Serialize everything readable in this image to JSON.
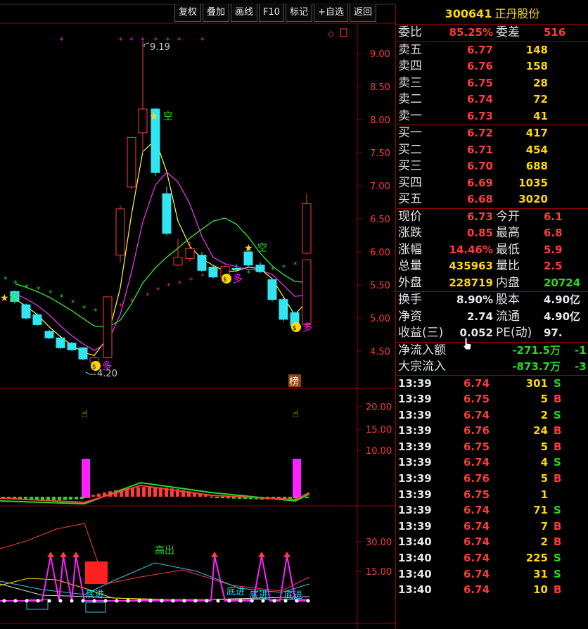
{
  "toolbar": {
    "buttons": [
      "复权",
      "叠加",
      "画线",
      "F10",
      "标记",
      "+自选",
      "返回"
    ]
  },
  "stock": {
    "code": "300641",
    "name": "正丹股份"
  },
  "chart": {
    "main_price_ticks": [
      "9.00",
      "8.50",
      "8.00",
      "7.50",
      "7.00",
      "6.50",
      "6.00",
      "5.50",
      "5.00",
      "4.50"
    ],
    "high_label": "9.19",
    "low_label": "4.20",
    "annotations": {
      "kong1": "空",
      "kong2": "空",
      "kong3": "空",
      "duo1": "多",
      "duo2": "多",
      "duo3": "多",
      "bang": "榜"
    },
    "macd_ticks": [
      "20.00",
      "15.00",
      "10.00"
    ],
    "kdj_ticks": [
      "30.00",
      "15.00"
    ],
    "sub_annotations": {
      "gaochu": "高出",
      "dijin1": "底进",
      "dijin2": "底进",
      "dijin3": "底进",
      "dijin4": "底进"
    },
    "candles": [
      {
        "o": 5.4,
        "c": 5.25,
        "h": 5.42,
        "l": 5.22
      },
      {
        "o": 5.2,
        "c": 5.0,
        "h": 5.22,
        "l": 4.98
      },
      {
        "o": 5.05,
        "c": 4.9,
        "h": 5.07,
        "l": 4.88
      },
      {
        "o": 4.8,
        "c": 4.7,
        "h": 4.82,
        "l": 4.68
      },
      {
        "o": 4.7,
        "c": 4.55,
        "h": 4.72,
        "l": 4.53
      },
      {
        "o": 4.62,
        "c": 4.52,
        "h": 4.64,
        "l": 4.5
      },
      {
        "o": 4.55,
        "c": 4.38,
        "h": 4.56,
        "l": 4.36
      },
      {
        "o": 4.33,
        "c": 4.4,
        "h": 4.42,
        "l": 4.2
      },
      {
        "o": 4.4,
        "c": 5.32,
        "h": 5.32,
        "l": 4.38
      },
      {
        "o": 5.95,
        "c": 6.65,
        "h": 6.7,
        "l": 5.85
      },
      {
        "o": 6.98,
        "c": 7.73,
        "h": 7.73,
        "l": 6.95
      },
      {
        "o": 7.8,
        "c": 8.16,
        "h": 9.19,
        "l": 7.5
      },
      {
        "o": 8.16,
        "c": 7.2,
        "h": 8.18,
        "l": 7.15
      },
      {
        "o": 6.88,
        "c": 6.28,
        "h": 6.99,
        "l": 6.25
      },
      {
        "o": 5.8,
        "c": 5.92,
        "h": 6.2,
        "l": 5.78
      },
      {
        "o": 5.9,
        "c": 6.05,
        "h": 6.15,
        "l": 5.85
      },
      {
        "o": 5.95,
        "c": 5.72,
        "h": 6.0,
        "l": 5.7
      },
      {
        "o": 5.77,
        "c": 5.62,
        "h": 5.8,
        "l": 5.6
      },
      {
        "o": 5.62,
        "c": 5.78,
        "h": 5.8,
        "l": 5.55
      },
      {
        "o": 5.75,
        "c": 5.73,
        "h": 5.82,
        "l": 5.7
      },
      {
        "o": 6.0,
        "c": 5.8,
        "h": 6.05,
        "l": 5.78
      },
      {
        "o": 5.8,
        "c": 5.7,
        "h": 5.85,
        "l": 5.68
      },
      {
        "o": 5.58,
        "c": 5.28,
        "h": 5.6,
        "l": 5.25
      },
      {
        "o": 5.28,
        "c": 4.98,
        "h": 5.3,
        "l": 4.95
      },
      {
        "o": 5.08,
        "c": 4.88,
        "h": 5.1,
        "l": 4.82
      },
      {
        "o": 4.9,
        "c": 5.88,
        "h": 5.88,
        "l": 4.85
      },
      {
        "o": 5.98,
        "c": 6.73,
        "h": 6.88,
        "l": 5.96
      }
    ]
  },
  "quote": {
    "weibi": {
      "label": "委比",
      "value": "85.25%",
      "label2": "委差",
      "value2": "516"
    },
    "asks": [
      {
        "label": "卖五",
        "price": "6.77",
        "vol": "148"
      },
      {
        "label": "卖四",
        "price": "6.76",
        "vol": "158"
      },
      {
        "label": "卖三",
        "price": "6.75",
        "vol": "28"
      },
      {
        "label": "卖二",
        "price": "6.74",
        "vol": "72"
      },
      {
        "label": "卖一",
        "price": "6.73",
        "vol": "41"
      }
    ],
    "bids": [
      {
        "label": "买一",
        "price": "6.72",
        "vol": "417"
      },
      {
        "label": "买二",
        "price": "6.71",
        "vol": "454"
      },
      {
        "label": "买三",
        "price": "6.70",
        "vol": "688"
      },
      {
        "label": "买四",
        "price": "6.69",
        "vol": "1035"
      },
      {
        "label": "买五",
        "price": "6.68",
        "vol": "3020"
      }
    ],
    "stats": [
      {
        "l1": "现价",
        "v1": "6.73",
        "l2": "今开",
        "v2": "6.1"
      },
      {
        "l1": "涨跌",
        "v1": "0.85",
        "l2": "最高",
        "v2": "6.8"
      },
      {
        "l1": "涨幅",
        "v1": "14.46%",
        "l2": "最低",
        "v2": "5.9"
      },
      {
        "l1": "总量",
        "v1": "435963",
        "l2": "量比",
        "v2": "2.5"
      },
      {
        "l1": "外盘",
        "v1": "228719",
        "l2": "内盘",
        "v2": "20724"
      }
    ],
    "fund": [
      {
        "l1": "换手",
        "v1": "8.90%",
        "l2": "股本",
        "v2": "4.90亿"
      },
      {
        "l1": "净资",
        "v1": "2.74",
        "l2": "流通",
        "v2": "4.90亿"
      },
      {
        "l1": "收益(三)",
        "v1": "0.052",
        "l2": "PE(动)",
        "v2": "97."
      }
    ],
    "flows": [
      {
        "label": "净流入额",
        "value": "-271.5万",
        "value2": "-1"
      },
      {
        "label": "大宗流入",
        "value": "-873.7万",
        "value2": "-3"
      }
    ]
  },
  "ticks": [
    {
      "t": "13:39",
      "p": "6.74",
      "v": "301",
      "f": "S"
    },
    {
      "t": "13:39",
      "p": "6.75",
      "v": "5",
      "f": "B"
    },
    {
      "t": "13:39",
      "p": "6.74",
      "v": "2",
      "f": "S"
    },
    {
      "t": "13:39",
      "p": "6.76",
      "v": "24",
      "f": "B"
    },
    {
      "t": "13:39",
      "p": "6.75",
      "v": "5",
      "f": "B"
    },
    {
      "t": "13:39",
      "p": "6.74",
      "v": "4",
      "f": "S"
    },
    {
      "t": "13:39",
      "p": "6.76",
      "v": "5",
      "f": "B"
    },
    {
      "t": "13:39",
      "p": "6.75",
      "v": "1",
      "f": ""
    },
    {
      "t": "13:39",
      "p": "6.74",
      "v": "71",
      "f": "S"
    },
    {
      "t": "13:39",
      "p": "6.74",
      "v": "7",
      "f": "B"
    },
    {
      "t": "13:40",
      "p": "6.74",
      "v": "2",
      "f": "B"
    },
    {
      "t": "13:40",
      "p": "6.74",
      "v": "225",
      "f": "S"
    },
    {
      "t": "13:40",
      "p": "6.74",
      "v": "31",
      "f": "S"
    },
    {
      "t": "13:40",
      "p": "6.74",
      "v": "10",
      "f": "B"
    }
  ],
  "colors": {
    "red": "#ff3b3b",
    "green": "#22dd22",
    "yellow": "#ffd700",
    "cyan": "#33e5f2",
    "magenta": "#ff22ff",
    "border": "#9b0000"
  }
}
